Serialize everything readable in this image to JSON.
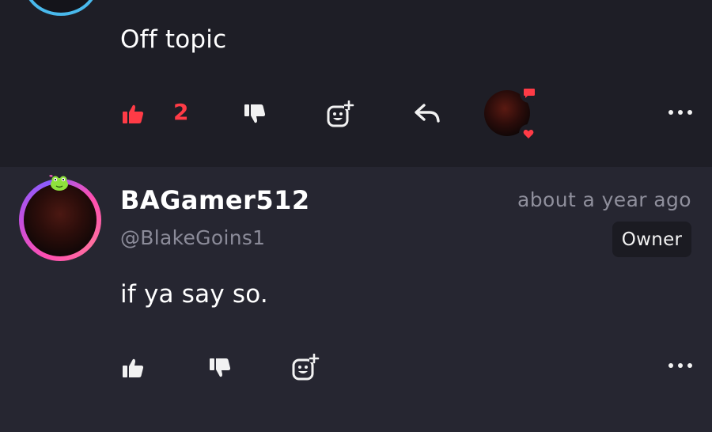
{
  "comment_top": {
    "text": "Off topic",
    "like_count": "2",
    "liked": true
  },
  "comment_reply": {
    "username": "BAGamer512",
    "handle": "@BlakeGoins1",
    "timestamp": "about a year ago",
    "role_badge": "Owner",
    "text": "if ya say so."
  },
  "colors": {
    "background": "#23232f",
    "accent_like": "#ff3b46",
    "muted_text": "#8b8b99",
    "avatar_ring": "#ff4fb0"
  },
  "icons": {
    "like": "thumbs-up-icon",
    "dislike": "thumbs-down-icon",
    "react": "add-reaction-icon",
    "reply": "reply-icon",
    "more": "more-horizontal-icon"
  }
}
